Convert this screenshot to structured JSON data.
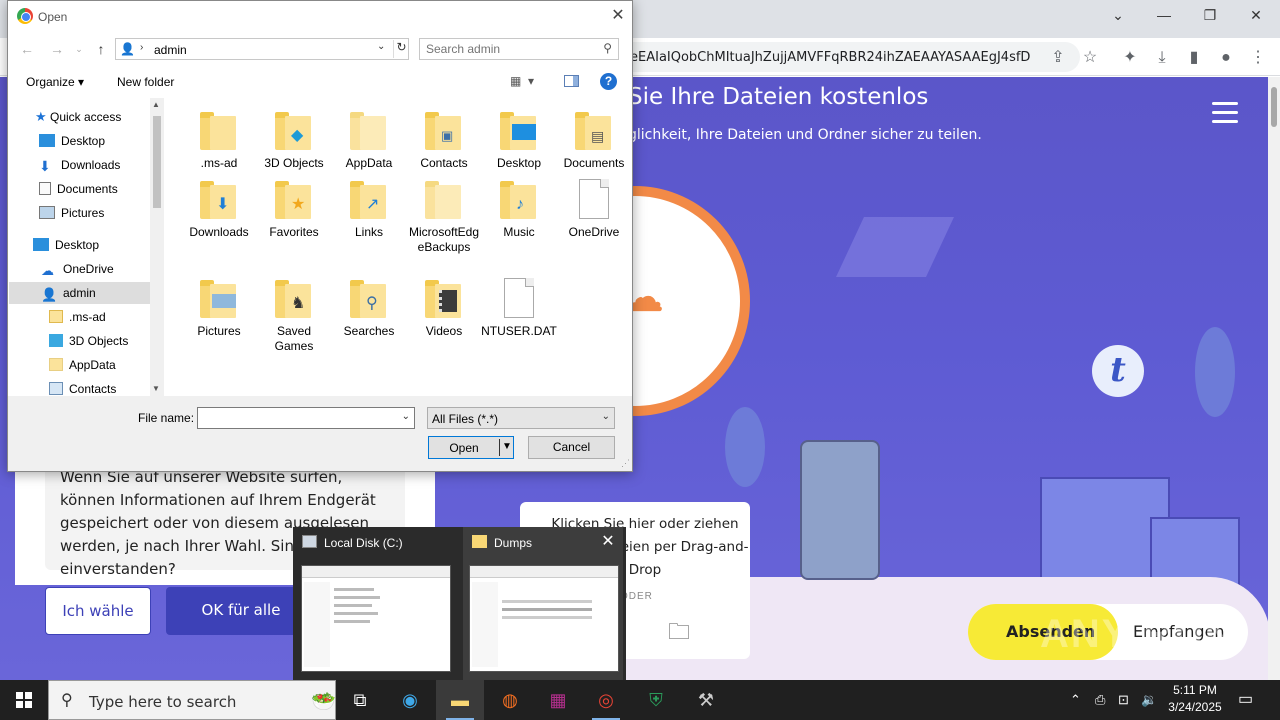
{
  "browser": {
    "url_fragment": "eEAIaIQobChMItuaJhZujjAMVFFqRBR24ihZAEAAYASAAEgJ4sfD_...",
    "window_controls": [
      "⌄",
      "—",
      "❐",
      "✕"
    ]
  },
  "website": {
    "headline": "Sie Ihre Dateien kostenlos",
    "subline": "glichkeit, Ihre Dateien und Ordner sicher zu teilen.",
    "cookie_text": "Wenn Sie auf unserer Website surfen, können Informationen auf Ihrem Endgerät gespeichert oder von diesem ausgelesen werden, je nach Ihrer Wahl. Sind Sie damit einverstanden?",
    "btn_choose": "Ich wähle",
    "btn_ok": "OK für alle",
    "upload_text": "Klicken Sie hier oder ziehen Sie Ihre Dateien per Drag-and-Drop",
    "upload_or": "ODER",
    "toggle_send": "Absenden",
    "toggle_receive": "Empfangen",
    "brand_letter": "t",
    "watermark": "ANY RUN"
  },
  "dialog": {
    "title": "Open",
    "address_path": "admin",
    "search_placeholder": "Search admin",
    "organize_label": "Organize ▾",
    "new_folder_label": "New folder",
    "help_label": "?",
    "nav_items": [
      {
        "label": "Quick access"
      },
      {
        "label": "Desktop"
      },
      {
        "label": "Downloads"
      },
      {
        "label": "Documents"
      },
      {
        "label": "Pictures"
      },
      {
        "label": "Desktop"
      },
      {
        "label": "OneDrive"
      },
      {
        "label": "admin"
      },
      {
        "label": ".ms-ad"
      },
      {
        "label": "3D Objects"
      },
      {
        "label": "AppData"
      },
      {
        "label": "Contacts"
      }
    ],
    "files": [
      {
        "label": ".ms-ad"
      },
      {
        "label": "3D Objects"
      },
      {
        "label": "AppData"
      },
      {
        "label": "Contacts"
      },
      {
        "label": "Desktop"
      },
      {
        "label": "Documents"
      },
      {
        "label": "Downloads"
      },
      {
        "label": "Favorites"
      },
      {
        "label": "Links"
      },
      {
        "label": "MicrosoftEdgeBackups"
      },
      {
        "label": "Music"
      },
      {
        "label": "OneDrive"
      },
      {
        "label": "Pictures"
      },
      {
        "label": "Saved Games"
      },
      {
        "label": "Searches"
      },
      {
        "label": "Videos"
      },
      {
        "label": "NTUSER.DAT"
      }
    ],
    "file_name_label": "File name:",
    "file_name_value": "",
    "file_type_value": "All Files (*.*)",
    "open_label": "Open",
    "cancel_label": "Cancel"
  },
  "thumbnails": [
    {
      "title": "Local Disk (C:)"
    },
    {
      "title": "Dumps"
    }
  ],
  "taskbar": {
    "search_placeholder": "Type here to search",
    "time": "5:11 PM",
    "date": "3/24/2025"
  }
}
